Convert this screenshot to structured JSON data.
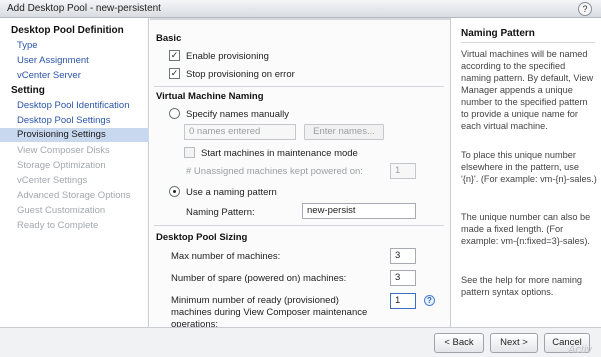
{
  "window": {
    "title": "Add Desktop Pool - new-persistent",
    "help_glyph": "?"
  },
  "sidebar": {
    "section1": "Desktop Pool Definition",
    "section1_items": [
      {
        "label": "Type",
        "state": "link"
      },
      {
        "label": "User Assignment",
        "state": "link"
      },
      {
        "label": "vCenter Server",
        "state": "link"
      }
    ],
    "section2": "Setting",
    "section2_items": [
      {
        "label": "Desktop Pool Identification",
        "state": "link"
      },
      {
        "label": "Desktop Pool Settings",
        "state": "link"
      },
      {
        "label": "Provisioning Settings",
        "state": "selected"
      },
      {
        "label": "View Composer Disks",
        "state": "disabled"
      },
      {
        "label": "Storage Optimization",
        "state": "disabled"
      },
      {
        "label": "vCenter Settings",
        "state": "disabled"
      },
      {
        "label": "Advanced Storage Options",
        "state": "disabled"
      },
      {
        "label": "Guest Customization",
        "state": "disabled"
      },
      {
        "label": "Ready to Complete",
        "state": "disabled"
      }
    ]
  },
  "basic": {
    "heading": "Basic",
    "enable_provisioning": {
      "label": "Enable provisioning",
      "checked": true,
      "mark": "✓"
    },
    "stop_on_error": {
      "label": "Stop provisioning on error",
      "checked": true,
      "mark": "✓"
    }
  },
  "naming": {
    "heading": "Virtual Machine Naming",
    "specify_manually": {
      "label": "Specify names manually",
      "selected": false
    },
    "names_entered_placeholder": "0 names entered",
    "enter_names_button": "Enter names...",
    "maintenance_mode": {
      "label": "Start machines in maintenance mode",
      "checked": false
    },
    "unassigned_label": "# Unassigned machines kept powered on:",
    "unassigned_value": "1",
    "use_pattern": {
      "label": "Use a naming pattern",
      "selected": true
    },
    "pattern_label": "Naming Pattern:",
    "pattern_value": "new-persist"
  },
  "sizing": {
    "heading": "Desktop Pool Sizing",
    "max_label": "Max number of machines:",
    "max_value": "3",
    "spare_label": "Number of spare (powered on) machines:",
    "spare_value": "3",
    "min_ready_label_1": "Minimum number of ready (provisioned)",
    "min_ready_label_2": "machines during View Composer maintenance",
    "min_ready_label_3": "operations:",
    "min_ready_value": "1",
    "help_glyph": "?"
  },
  "help_panel": {
    "title": "Naming Pattern",
    "p1": "Virtual machines will be named according to the specified naming pattern. By default, View Manager appends a unique number to the specified pattern to provide a unique name for each virtual machine.",
    "p2": "To place this unique number elsewhere in the pattern, use '{n}'. (For example: vm-{n}-sales.)",
    "p3": "The unique number can also be made a fixed length. (For example: vm-{n:fixed=3}-sales).",
    "p4": "See the help for more naming pattern syntax options."
  },
  "footer": {
    "back": "< Back",
    "next": "Next >",
    "cancel": "Cancel",
    "watermark": "Activ"
  }
}
